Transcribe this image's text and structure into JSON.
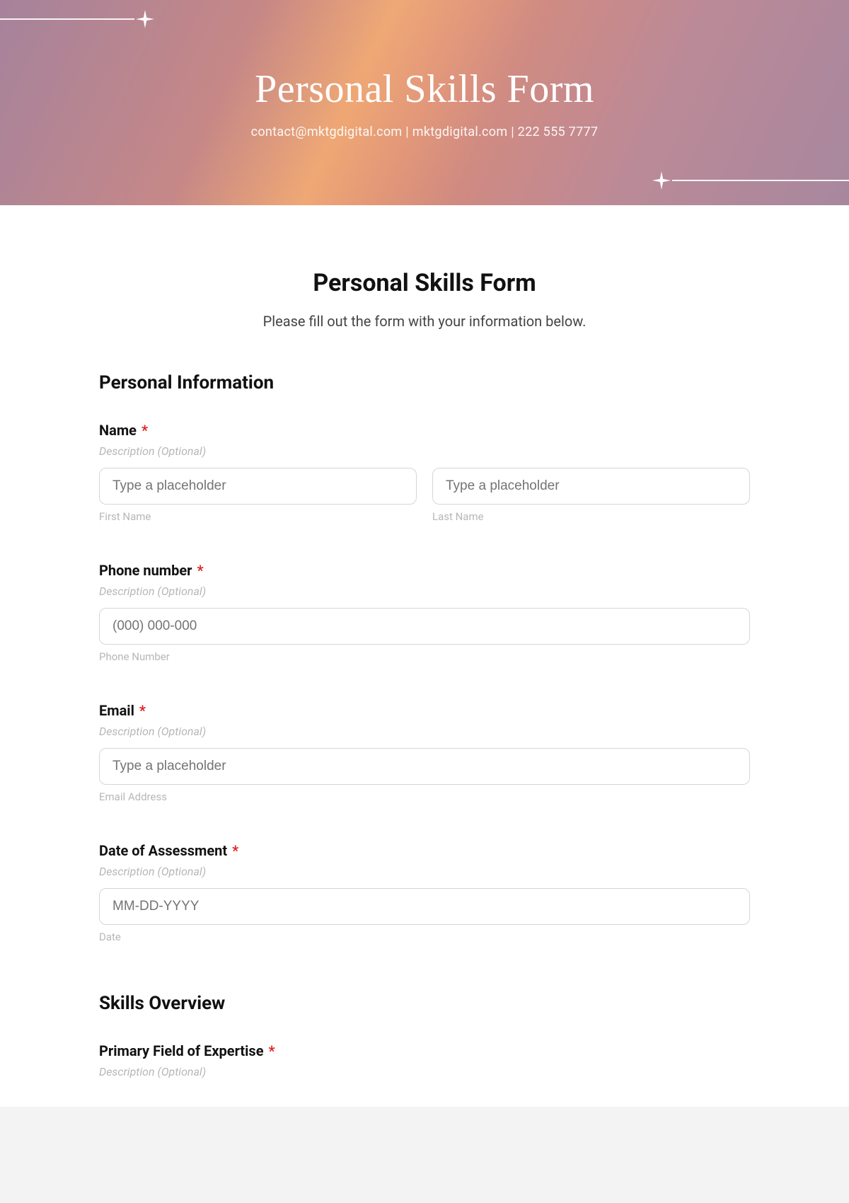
{
  "hero": {
    "title": "Personal Skills Form",
    "subtitle": "contact@mktgdigital.com | mktgdigital.com | 222 555 7777"
  },
  "form": {
    "title": "Personal Skills Form",
    "intro": "Please fill out the form with your information below."
  },
  "section_personal": "Personal Information",
  "section_skills": "Skills Overview",
  "description_optional": "Description (Optional)",
  "required_mark": "*",
  "fields": {
    "name": {
      "label": "Name",
      "first_placeholder": "Type a placeholder",
      "first_sub": "First Name",
      "last_placeholder": "Type a placeholder",
      "last_sub": "Last Name"
    },
    "phone": {
      "label": "Phone number",
      "placeholder": "(000) 000-000",
      "sub": "Phone Number"
    },
    "email": {
      "label": "Email",
      "placeholder": "Type a placeholder",
      "sub": "Email Address"
    },
    "date": {
      "label": "Date of Assessment",
      "placeholder": "MM-DD-YYYY",
      "sub": "Date"
    },
    "expertise": {
      "label": "Primary Field of Expertise"
    }
  }
}
